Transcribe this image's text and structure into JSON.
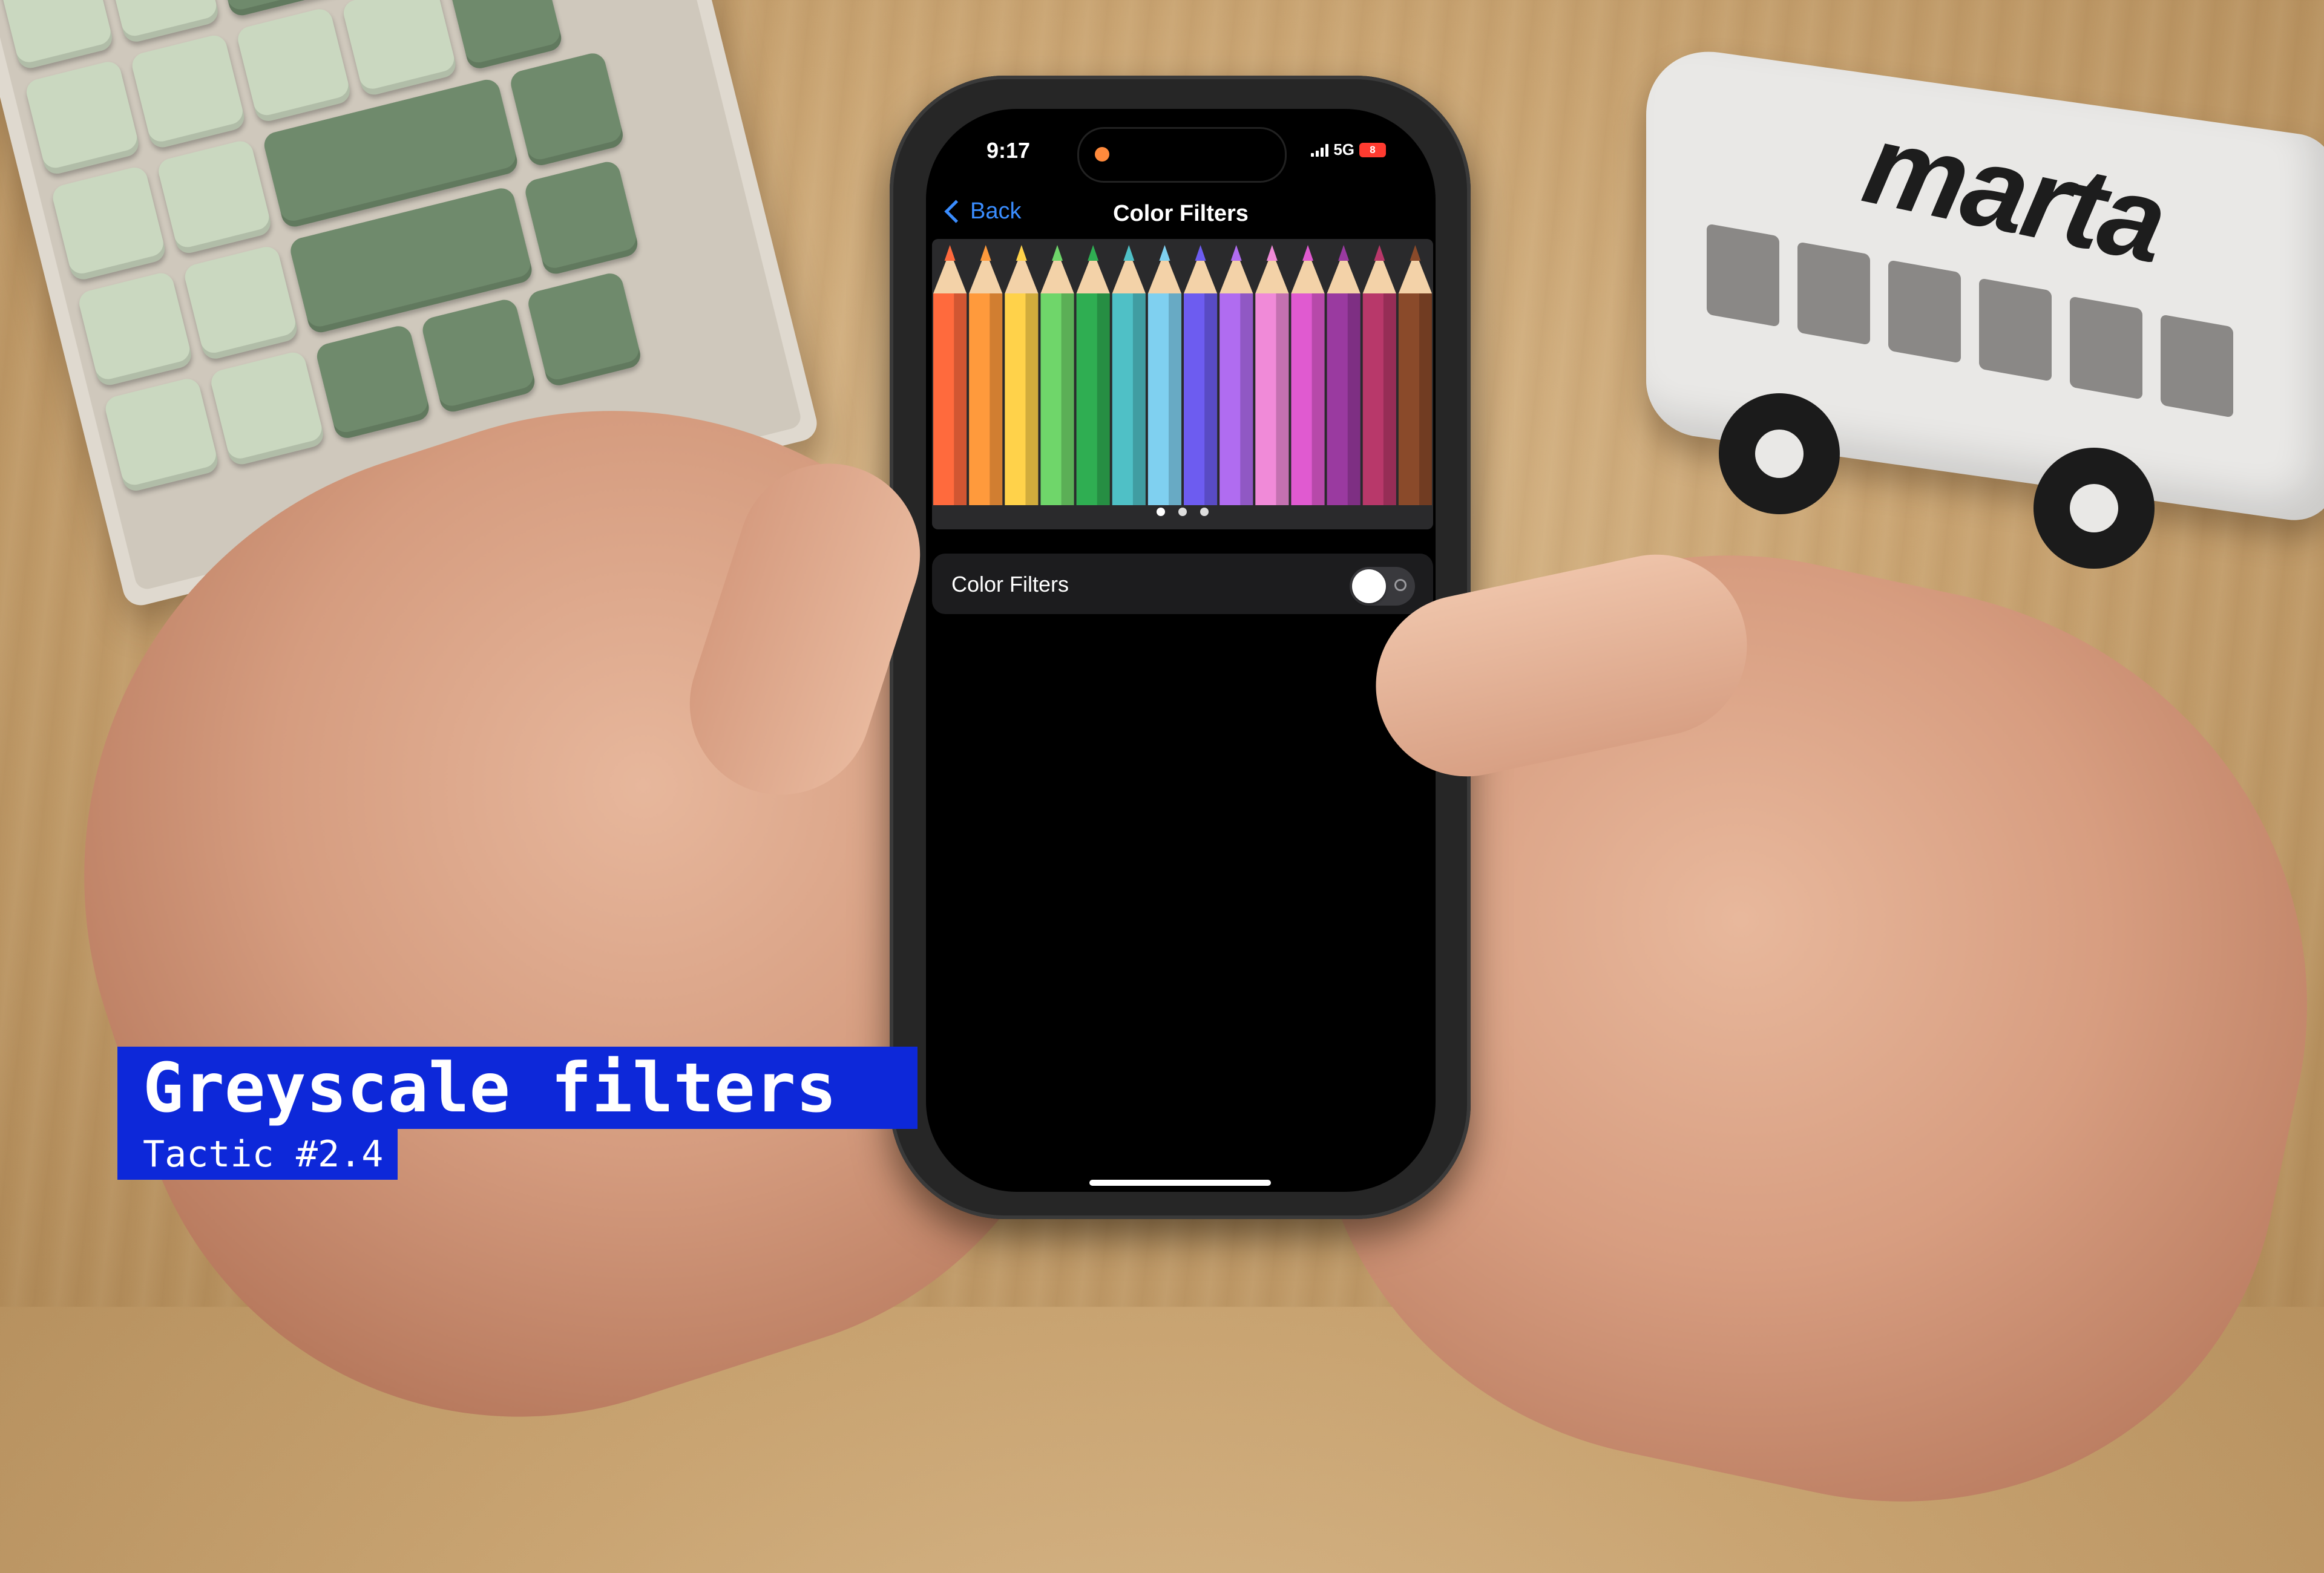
{
  "status_bar": {
    "time": "9:17",
    "network": "5G",
    "battery": "8"
  },
  "nav": {
    "back_label": "Back",
    "title": "Color Filters"
  },
  "preview": {
    "pencil_colors": [
      "#ff6a3d",
      "#ff9a3c",
      "#ffd24a",
      "#6fd66a",
      "#2fae52",
      "#4fc0c6",
      "#7fd0f0",
      "#6d5cf0",
      "#b06cf0",
      "#f08ad8",
      "#e05ad0",
      "#9a3aa0",
      "#b8386a",
      "#8a4a2a"
    ],
    "page_dots": 3,
    "active_page": 0
  },
  "settings": {
    "color_filters_label": "Color Filters",
    "color_filters_on": false
  },
  "caption": {
    "title": "Greyscale filters",
    "subtitle": "Tactic #2.4"
  },
  "scene": {
    "bus_logo": "marta"
  }
}
